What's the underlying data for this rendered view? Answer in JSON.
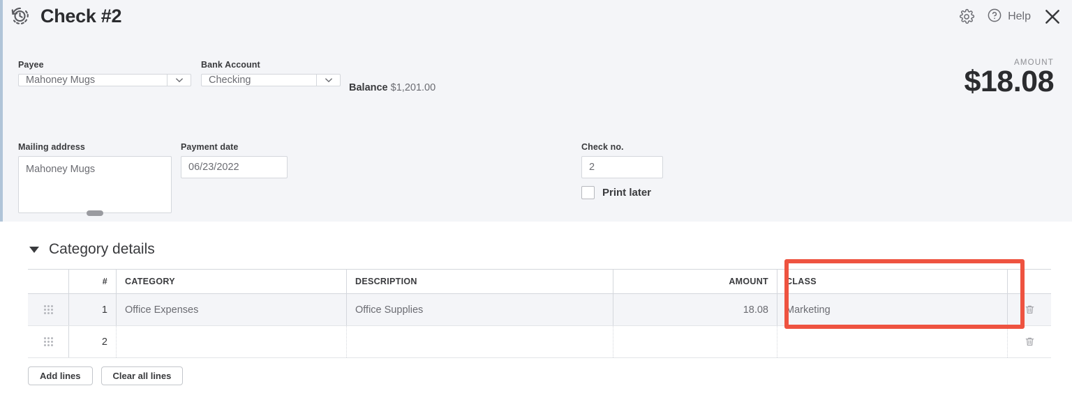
{
  "header": {
    "title": "Check #2",
    "history_icon": "history-clock-icon",
    "gear_icon": "gear-icon",
    "help_icon": "question-circle-icon",
    "help_label": "Help",
    "close_icon": "close-x-icon"
  },
  "form": {
    "payee": {
      "label": "Payee",
      "value": "Mahoney Mugs"
    },
    "bank_account": {
      "label": "Bank Account",
      "value": "Checking"
    },
    "balance": {
      "label": "Balance",
      "value": "$1,201.00"
    },
    "amount": {
      "caption": "AMOUNT",
      "value": "$18.08"
    },
    "mailing_address": {
      "label": "Mailing address",
      "value": "Mahoney Mugs"
    },
    "payment_date": {
      "label": "Payment date",
      "value": "06/23/2022"
    },
    "check_no": {
      "label": "Check no.",
      "value": "2"
    },
    "print_later": {
      "label": "Print later",
      "checked": false
    }
  },
  "category_details": {
    "section_title": "Category details",
    "expanded": true,
    "columns": [
      "",
      "#",
      "CATEGORY",
      "DESCRIPTION",
      "AMOUNT",
      "CLASS",
      ""
    ],
    "rows": [
      {
        "num": "1",
        "category": "Office Expenses",
        "description": "Office Supplies",
        "amount": "18.08",
        "class": "Marketing"
      },
      {
        "num": "2",
        "category": "",
        "description": "",
        "amount": "",
        "class": ""
      }
    ],
    "add_lines_label": "Add lines",
    "clear_all_lines_label": "Clear all lines"
  },
  "annotation": {
    "highlight_color": "#ee5340",
    "target": "CLASS"
  },
  "colors": {
    "panel_bg": "#f4f5f8",
    "body_bg": "#ffffff",
    "text": "#393a3d",
    "muted_text": "#6b6c72",
    "border": "#d4d7dc",
    "accent_line": "#b0c4d8"
  }
}
